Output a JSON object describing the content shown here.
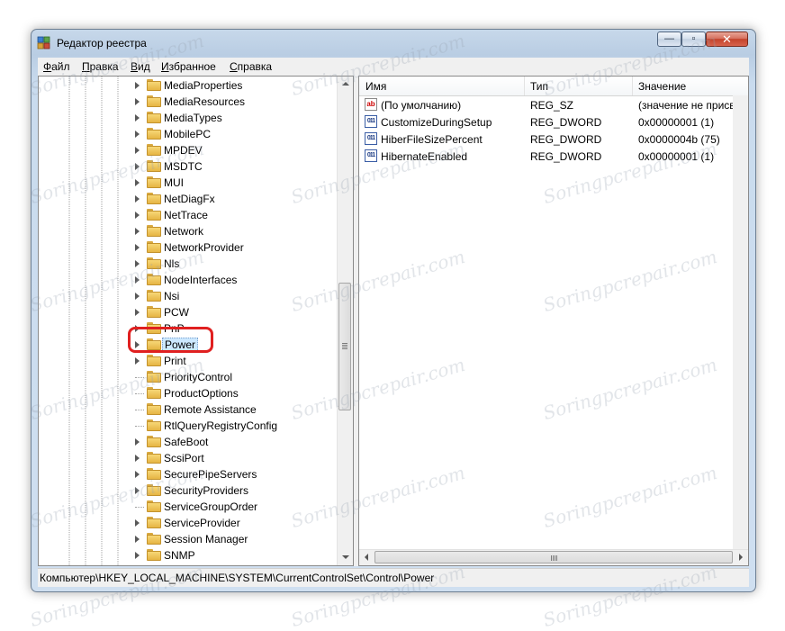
{
  "window": {
    "title": "Редактор реестра",
    "controls": {
      "minimize": "—",
      "maximize": "▫",
      "close": "✕"
    }
  },
  "menu": [
    {
      "underline": "Ф",
      "rest": "айл"
    },
    {
      "underline": "П",
      "rest": "равка"
    },
    {
      "underline": "В",
      "rest": "ид"
    },
    {
      "underline": "И",
      "rest": "збранное"
    },
    {
      "underline": "С",
      "rest": "правка"
    }
  ],
  "tree": {
    "items": [
      {
        "label": "MediaProperties",
        "expandable": true
      },
      {
        "label": "MediaResources",
        "expandable": true
      },
      {
        "label": "MediaTypes",
        "expandable": true
      },
      {
        "label": "MobilePC",
        "expandable": true
      },
      {
        "label": "MPDEV",
        "expandable": true
      },
      {
        "label": "MSDTC",
        "expandable": true
      },
      {
        "label": "MUI",
        "expandable": true
      },
      {
        "label": "NetDiagFx",
        "expandable": true
      },
      {
        "label": "NetTrace",
        "expandable": true
      },
      {
        "label": "Network",
        "expandable": true
      },
      {
        "label": "NetworkProvider",
        "expandable": true
      },
      {
        "label": "Nls",
        "expandable": true
      },
      {
        "label": "NodeInterfaces",
        "expandable": true
      },
      {
        "label": "Nsi",
        "expandable": true
      },
      {
        "label": "PCW",
        "expandable": true
      },
      {
        "label": "PnP",
        "expandable": true
      },
      {
        "label": "Power",
        "expandable": true,
        "selected": true
      },
      {
        "label": "Print",
        "expandable": true
      },
      {
        "label": "PriorityControl",
        "expandable": false
      },
      {
        "label": "ProductOptions",
        "expandable": false
      },
      {
        "label": "Remote Assistance",
        "expandable": false
      },
      {
        "label": "RtlQueryRegistryConfig",
        "expandable": false
      },
      {
        "label": "SafeBoot",
        "expandable": true
      },
      {
        "label": "ScsiPort",
        "expandable": true
      },
      {
        "label": "SecurePipeServers",
        "expandable": true
      },
      {
        "label": "SecurityProviders",
        "expandable": true
      },
      {
        "label": "ServiceGroupOrder",
        "expandable": false
      },
      {
        "label": "ServiceProvider",
        "expandable": true
      },
      {
        "label": "Session Manager",
        "expandable": true
      },
      {
        "label": "SNMP",
        "expandable": true
      }
    ]
  },
  "list": {
    "headers": {
      "name": "Имя",
      "type": "Тип",
      "value": "Значение"
    },
    "rows": [
      {
        "icon": "ab",
        "icon_name": "string-value-icon",
        "name": "(По умолчанию)",
        "type": "REG_SZ",
        "value": "(значение не присвоено)"
      },
      {
        "icon": "011",
        "icon_name": "dword-value-icon",
        "name": "CustomizeDuringSetup",
        "type": "REG_DWORD",
        "value": "0x00000001 (1)"
      },
      {
        "icon": "011",
        "icon_name": "dword-value-icon",
        "name": "HiberFileSizePercent",
        "type": "REG_DWORD",
        "value": "0x0000004b (75)"
      },
      {
        "icon": "011",
        "icon_name": "dword-value-icon",
        "name": "HibernateEnabled",
        "type": "REG_DWORD",
        "value": "0x00000001 (1)"
      }
    ]
  },
  "status": {
    "path": "Компьютер\\HKEY_LOCAL_MACHINE\\SYSTEM\\CurrentControlSet\\Control\\Power"
  },
  "watermark": "Soringpcrepair.com",
  "colors": {
    "selection": "#cce8ff",
    "highlight_ring": "#e02020",
    "folder": "#f7d777"
  }
}
